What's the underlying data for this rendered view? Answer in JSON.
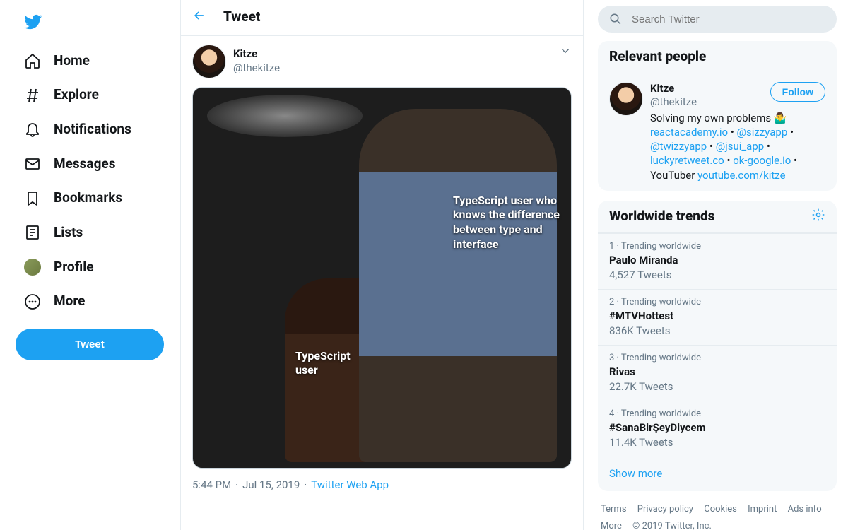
{
  "nav": {
    "home": "Home",
    "explore": "Explore",
    "notifications": "Notifications",
    "messages": "Messages",
    "bookmarks": "Bookmarks",
    "lists": "Lists",
    "profile": "Profile",
    "more": "More",
    "tweet_button": "Tweet"
  },
  "header": {
    "title": "Tweet"
  },
  "tweet": {
    "author_name": "Kitze",
    "author_handle": "@thekitze",
    "captions": {
      "left": "TypeScript user",
      "right": "TypeScript user who knows the difference between type and interface"
    },
    "time": "5:44 PM",
    "date": "Jul 15, 2019",
    "source": "Twitter Web App"
  },
  "search": {
    "placeholder": "Search Twitter"
  },
  "relevant": {
    "heading": "Relevant people",
    "person": {
      "name": "Kitze",
      "handle": "@thekitze",
      "follow": "Follow",
      "bio_pre": "Solving my own problems 🤷‍♂️ ",
      "links": [
        "reactacademy.io",
        "@sizzyapp",
        "@twizzyapp",
        "@jsui_app",
        "luckyretweet.co",
        "ok-google.io"
      ],
      "sep": " • ",
      "bio_suf": "YouTuber ",
      "yt": "youtube.com/kitze"
    }
  },
  "trends": {
    "heading": "Worldwide trends",
    "items": [
      {
        "rank": "1",
        "ctx": "Trending worldwide",
        "topic": "Paulo Miranda",
        "count": "4,527 Tweets"
      },
      {
        "rank": "2",
        "ctx": "Trending worldwide",
        "topic": "#MTVHottest",
        "count": "836K Tweets"
      },
      {
        "rank": "3",
        "ctx": "Trending worldwide",
        "topic": "Rivas",
        "count": "22.7K Tweets"
      },
      {
        "rank": "4",
        "ctx": "Trending worldwide",
        "topic": "#SanaBirŞeyDiycem",
        "count": "11.4K Tweets"
      }
    ],
    "showmore": "Show more"
  },
  "footer": {
    "links": [
      "Terms",
      "Privacy policy",
      "Cookies",
      "Imprint",
      "Ads info",
      "More "
    ],
    "copyright": "© 2019 Twitter, Inc."
  }
}
